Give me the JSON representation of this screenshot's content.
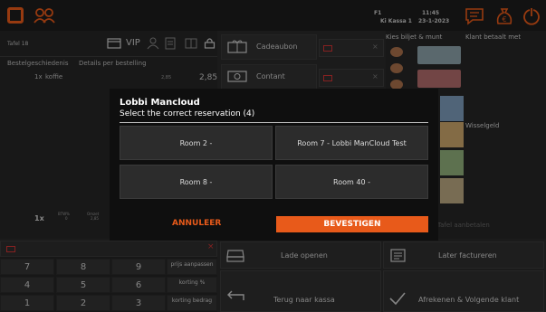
{
  "header": {
    "printer": "F1",
    "register": "Ki Kassa 1",
    "time": "11:45",
    "date": "23-1-2023"
  },
  "order": {
    "table": "Tafel 18",
    "vip": "VIP",
    "tab_history": "Bestelgeschiedenis",
    "tab_details": "Details per bestelling",
    "item_qty": "1x",
    "item_name": "koffie",
    "item_unit": "2,85",
    "item_total": "2,85",
    "footer_qty": "1x",
    "footer_vat_label": "BTW%",
    "footer_vat_value": "0",
    "footer_left_label": "Omzet",
    "footer_left_value": "2,85"
  },
  "payments": {
    "gift": "Cadeaubon",
    "cash": "Contant"
  },
  "right_panel": {
    "choose_label": "Kies biljet & munt",
    "customer_paid": "Klant betaalt met",
    "change": "Wisselgeld",
    "adjust_table": "Tafel aanbetalen"
  },
  "keypad": {
    "keys": [
      "7",
      "8",
      "9",
      "4",
      "5",
      "6",
      "1",
      "2",
      "3"
    ],
    "adjust_price": "prijs aanpassen",
    "discount_pct": "korting %",
    "discount_amount": "korting bedrag"
  },
  "actions": {
    "open_drawer": "Lade openen",
    "invoice_later": "Later factureren",
    "back_to_register": "Terug naar kassa",
    "settle_next": "Afrekenen & Volgende klant"
  },
  "modal": {
    "title": "Lobbi Mancloud",
    "subtitle": "Select the correct reservation (4)",
    "options": [
      "Room 2 -",
      "Room 7 - Lobbi ManCloud Test",
      "Room 8 -",
      "Room 40 -"
    ],
    "cancel": "ANNULEER",
    "confirm": "BEVESTIGEN"
  },
  "colors": {
    "accent": "#e85a1a",
    "background": "#2a2a2a",
    "modal": "#0f0f0f"
  }
}
